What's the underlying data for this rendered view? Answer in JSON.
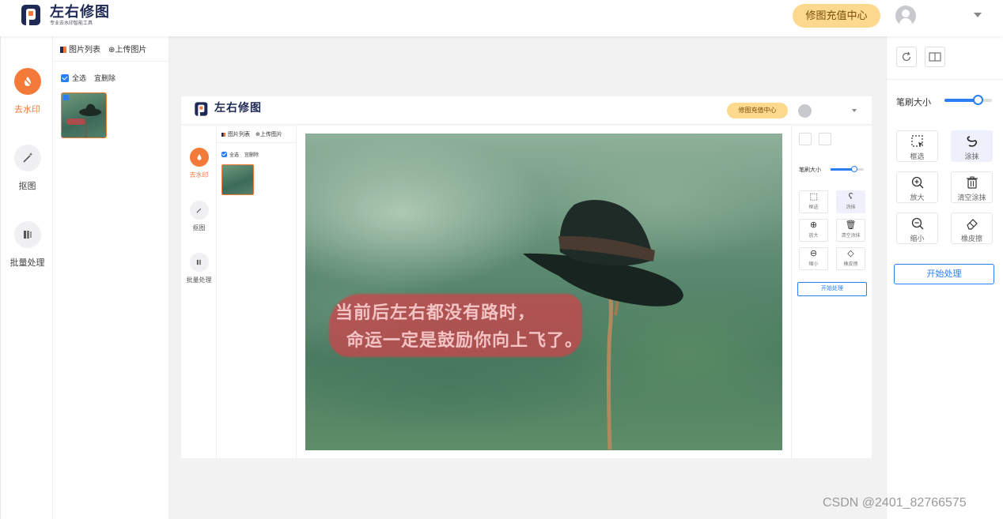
{
  "app": {
    "brand": "左右修图",
    "slogan": "专业去水印智能工具"
  },
  "header": {
    "recharge_label": "修图充值中心"
  },
  "nav": {
    "items": [
      {
        "label": "去水印",
        "icon": "droplet-slash-icon",
        "active": true
      },
      {
        "label": "抠图",
        "icon": "magic-wand-icon",
        "active": false
      },
      {
        "label": "批量处理",
        "icon": "stack-icon",
        "active": false
      }
    ]
  },
  "list_panel": {
    "tab_list": "图片列表",
    "tab_upload": "⊕上传图片",
    "select_all": "全选",
    "delete": "宜删除"
  },
  "tools": {
    "refresh_icon": "refresh-icon",
    "compare_icon": "split-view-icon",
    "brush_size_label": "笔刷大小",
    "brush_size_value": 0.7,
    "items": [
      {
        "label": "框选",
        "icon": "box-select-icon",
        "active": false
      },
      {
        "label": "涂抹",
        "icon": "lasso-icon",
        "active": true
      },
      {
        "label": "放大",
        "icon": "zoom-in-icon",
        "active": false
      },
      {
        "label": "清空涂抹",
        "icon": "trash-icon",
        "active": false
      },
      {
        "label": "缩小",
        "icon": "zoom-out-icon",
        "active": false
      },
      {
        "label": "橡皮擦",
        "icon": "eraser-icon",
        "active": false
      }
    ],
    "start_label": "开始处理"
  },
  "inner": {
    "brand": "左右修图",
    "recharge_label": "修图充值中心",
    "nav": [
      "去水印",
      "抠图",
      "批量处理"
    ],
    "tab_list": "图片列表",
    "tab_upload": "⊕上传图片",
    "select_all": "全选",
    "delete": "宜删除",
    "brush_size_label": "笔刷大小",
    "tools": [
      "框选",
      "涂抹",
      "放大",
      "清空涂抹",
      "缩小",
      "橡皮擦"
    ],
    "start_label": "开始处理",
    "caption_line1": "当前后左右都没有路时，",
    "caption_line2": "命运一定是鼓励你向上飞了。"
  },
  "watermark": "CSDN @2401_82766575",
  "colors": {
    "accent": "#f47a3a",
    "primary": "#2a7ef4",
    "recharge_bg": "#fcd98c",
    "brand_navy": "#1e2a55"
  }
}
